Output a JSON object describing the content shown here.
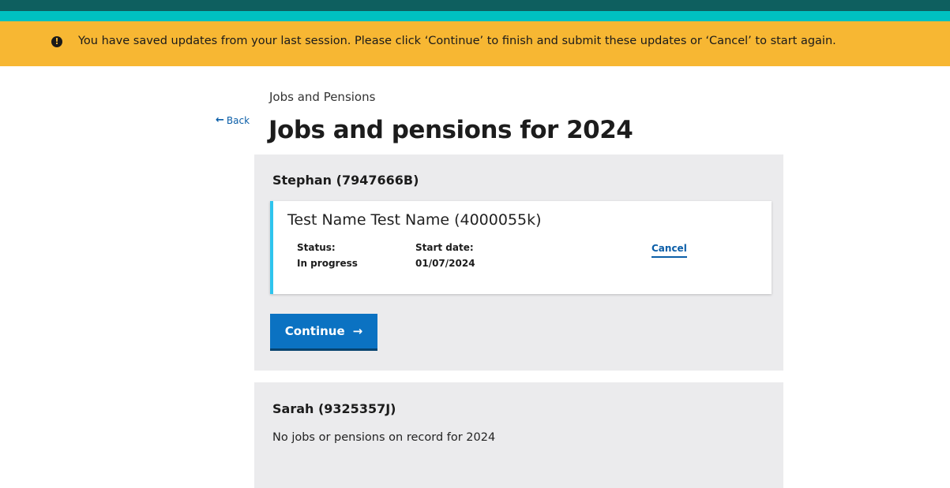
{
  "banner": {
    "icon": "exclamation-circle-icon",
    "message": "You have saved updates from your last session. Please click ‘Continue’ to finish and submit these updates or ‘Cancel’ to start again.",
    "color": "#f7b733"
  },
  "header": {
    "stripe_colors": [
      "#0e5f5f",
      "#00c1c1"
    ]
  },
  "nav": {
    "breadcrumb": "Jobs and Pensions",
    "back_label": "Back",
    "back_icon": "arrow-left-icon"
  },
  "page": {
    "title": "Jobs and pensions for 2024"
  },
  "people": [
    {
      "heading": "Stephan (7947666B)",
      "record": {
        "title": "Test Name Test Name (4000055k)",
        "status_label": "Status:",
        "status_value": "In progress",
        "start_label": "Start date:",
        "start_value": "01/07/2024",
        "cancel_label": "Cancel"
      },
      "continue_label": "Continue",
      "continue_icon": "arrow-right-icon"
    },
    {
      "heading": "Sarah (9325357J)",
      "empty_message": "No jobs or pensions on record for 2024"
    }
  ]
}
